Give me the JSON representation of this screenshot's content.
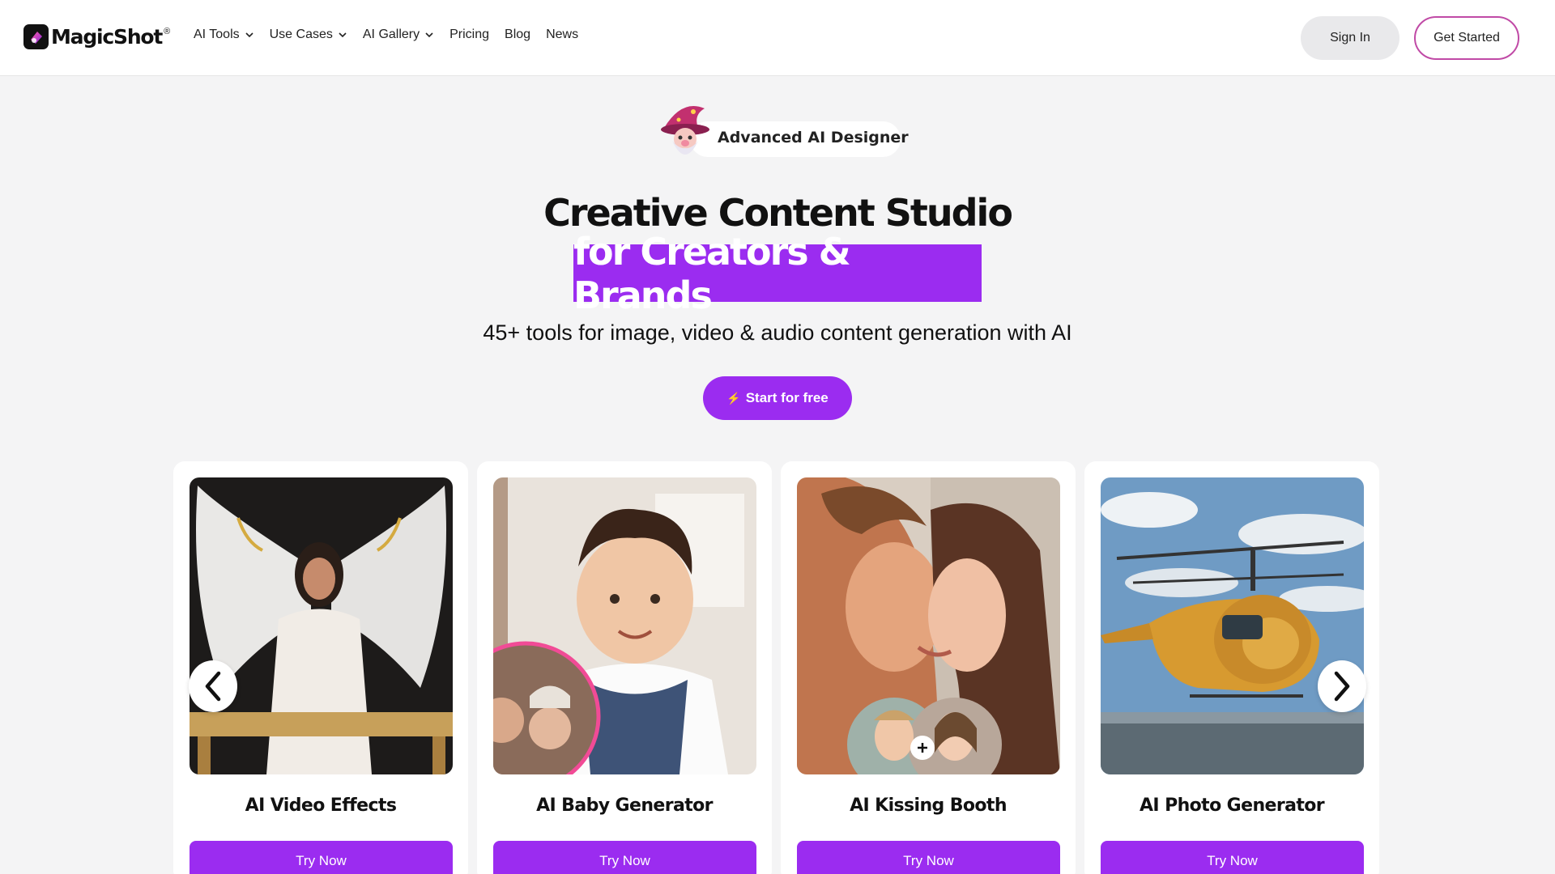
{
  "header": {
    "logo_text": "MagicShot",
    "logo_reg": "®",
    "nav": [
      {
        "label": "AI Tools",
        "dropdown": true
      },
      {
        "label": "Use Cases",
        "dropdown": true
      },
      {
        "label": "AI Gallery",
        "dropdown": true
      },
      {
        "label": "Pricing",
        "dropdown": false
      },
      {
        "label": "Blog",
        "dropdown": false
      },
      {
        "label": "News",
        "dropdown": false
      }
    ],
    "sign_in": "Sign In",
    "get_started": "Get Started"
  },
  "hero": {
    "badge": "Advanced AI Designer",
    "title": "Creative Content Studio",
    "highlight": "for Creators & Brands",
    "subtitle": "45+ tools for image, video & audio content generation with AI",
    "cta": "Start for free"
  },
  "cards": [
    {
      "title": "AI Video Effects",
      "button": "Try Now"
    },
    {
      "title": "AI Baby Generator",
      "button": "Try Now"
    },
    {
      "title": "AI Kissing Booth",
      "button": "Try Now"
    },
    {
      "title": "AI Photo Generator",
      "button": "Try Now"
    }
  ],
  "colors": {
    "accent": "#9b2cf0",
    "get_started_border": "#c04aa6",
    "page_bg": "#f4f4f5"
  },
  "icons": {
    "prev": "chevron-left-icon",
    "next": "chevron-right-icon",
    "nav_dropdown": "chevron-down-icon",
    "cta": "bolt-icon"
  }
}
